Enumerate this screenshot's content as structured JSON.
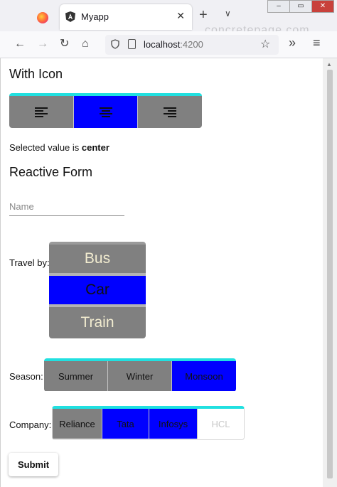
{
  "browser": {
    "tab_title": "Myapp",
    "tab_close": "✕",
    "new_tab": "+",
    "tab_list": "∨",
    "url_host": "localhost",
    "url_port": ":4200",
    "watermark": "concretepage.com",
    "nav": {
      "back": "←",
      "forward": "→",
      "reload": "↻",
      "home": "⌂",
      "star": "☆",
      "overflow": "»",
      "menu": "≡"
    },
    "window": {
      "minimize": "–",
      "restore": "▭",
      "close": "✕"
    }
  },
  "page": {
    "icon_heading": "With Icon",
    "align_buttons": [
      {
        "icon": "format-align-left-icon",
        "color": "#808080"
      },
      {
        "icon": "format-align-center-icon",
        "color": "#0000ff",
        "selected": true
      },
      {
        "icon": "format-align-right-icon",
        "color": "#808080"
      }
    ],
    "selected_prefix": "Selected value is",
    "selected_value": "center",
    "form_heading": "Reactive Form",
    "name_placeholder": "Name",
    "travel_label": "Travel by:",
    "travel_options": [
      "Bus",
      "Car",
      "Train"
    ],
    "season_label": "Season:",
    "season_options": [
      "Summer",
      "Winter",
      "Monsoon"
    ],
    "company_label": "Company:",
    "company_options": [
      "Reliance",
      "Tata",
      "Infosys",
      "HCL"
    ],
    "submit_label": "Submit"
  },
  "colors": {
    "accent": "#21e0e0",
    "selected": "#0000ff",
    "unselected": "#808080",
    "disabled_text": "#c8c8c8"
  }
}
